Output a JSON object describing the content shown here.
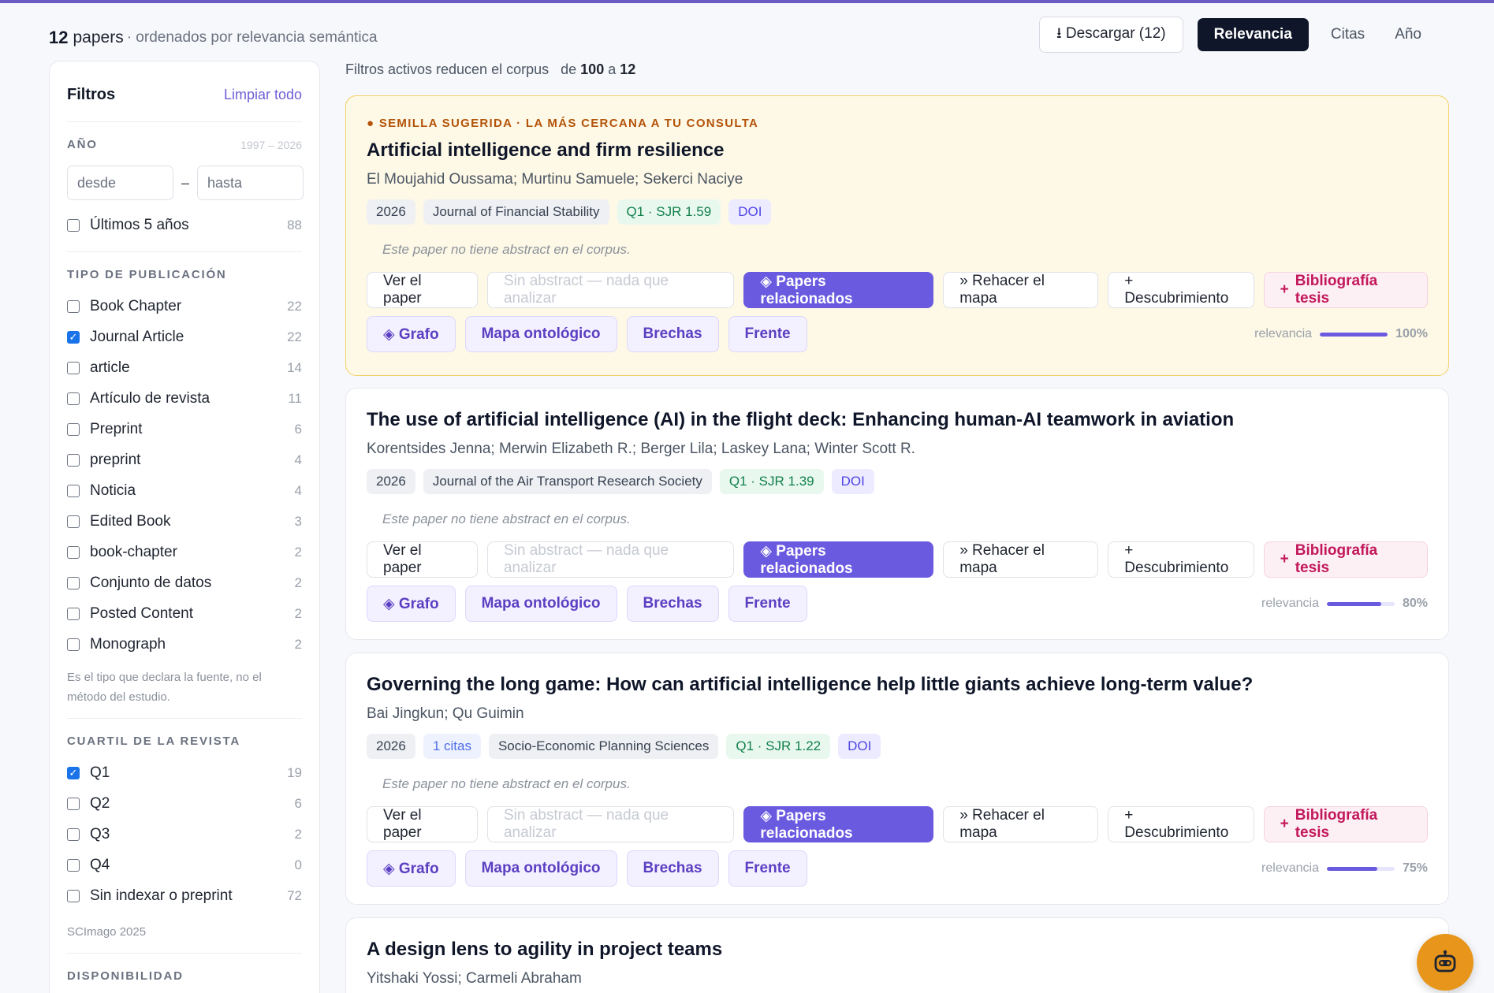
{
  "header": {
    "count": "12",
    "count_word": "papers",
    "sorted_by": "· ordenados por relevancia semántica",
    "download": "⭳ Descargar (12)",
    "sort_active": "Relevancia",
    "sort_citas": "Citas",
    "sort_year": "Año"
  },
  "sidebar": {
    "title": "Filtros",
    "clear": "Limpiar todo",
    "year": {
      "label": "AÑO",
      "range": "1997 – 2026",
      "from_placeholder": "desde",
      "to_placeholder": "hasta",
      "dash": "–",
      "last5_label": "Últimos 5 años",
      "last5_count": "88",
      "last5_checked": false
    },
    "pubtype": {
      "label": "TIPO DE PUBLICACIÓN",
      "items": [
        {
          "label": "Book Chapter",
          "count": "22",
          "checked": false
        },
        {
          "label": "Journal Article",
          "count": "22",
          "checked": true
        },
        {
          "label": "article",
          "count": "14",
          "checked": false
        },
        {
          "label": "Artículo de revista",
          "count": "11",
          "checked": false
        },
        {
          "label": "Preprint",
          "count": "6",
          "checked": false
        },
        {
          "label": "preprint",
          "count": "4",
          "checked": false
        },
        {
          "label": "Noticia",
          "count": "4",
          "checked": false
        },
        {
          "label": "Edited Book",
          "count": "3",
          "checked": false
        },
        {
          "label": "book-chapter",
          "count": "2",
          "checked": false
        },
        {
          "label": "Conjunto de datos",
          "count": "2",
          "checked": false
        },
        {
          "label": "Posted Content",
          "count": "2",
          "checked": false
        },
        {
          "label": "Monograph",
          "count": "2",
          "checked": false
        }
      ],
      "note": "Es el tipo que declara la fuente, no el método del estudio."
    },
    "quartile": {
      "label": "CUARTIL DE LA REVISTA",
      "items": [
        {
          "label": "Q1",
          "count": "19",
          "checked": true
        },
        {
          "label": "Q2",
          "count": "6",
          "checked": false
        },
        {
          "label": "Q3",
          "count": "2",
          "checked": false
        },
        {
          "label": "Q4",
          "count": "0",
          "checked": false
        },
        {
          "label": "Sin indexar o preprint",
          "count": "72",
          "checked": false
        }
      ],
      "note": "SCImago 2025"
    },
    "availability": {
      "label": "DISPONIBILIDAD"
    }
  },
  "corpus": {
    "prefix": "Filtros activos reducen el corpus",
    "de": "de",
    "from": "100",
    "a": "a",
    "to": "12"
  },
  "labels": {
    "ver": "Ver el paper",
    "sin_abstract": "Sin abstract — nada que analizar",
    "relacionados": "◈ Papers relacionados",
    "rehacer": "» Rehacer el mapa",
    "descubrimiento": "+ Descubrimiento",
    "bib_plus": "+",
    "bibliografia": "Bibliografía tesis",
    "grafo": "◈ Grafo",
    "mapa": "Mapa ontológico",
    "brechas": "Brechas",
    "frente": "Frente",
    "relevancia": "relevancia",
    "no_abstract": "Este paper no tiene abstract en el corpus."
  },
  "papers": [
    {
      "seed_tag": "● SEMILLA SUGERIDA · LA MÁS CERCANA A TU CONSULTA",
      "title": "Artificial intelligence and firm resilience",
      "authors": "El Moujahid Oussama; Murtinu Samuele; Sekerci Naciye",
      "year": "2026",
      "journal": "Journal of Financial Stability",
      "quartile": "Q1 · SJR 1.59",
      "doi": "DOI",
      "relevance": 100,
      "relevance_label": "100%"
    },
    {
      "title": "The use of artificial intelligence (AI) in the flight deck: Enhancing human-AI teamwork in aviation",
      "authors": "Korentsides Jenna; Merwin Elizabeth R.; Berger Lila; Laskey Lana; Winter Scott R.",
      "year": "2026",
      "journal": "Journal of the Air Transport Research Society",
      "quartile": "Q1 · SJR 1.39",
      "doi": "DOI",
      "relevance": 80,
      "relevance_label": "80%"
    },
    {
      "title": "Governing the long game: How can artificial intelligence help little giants achieve long-term value?",
      "authors": "Bai Jingkun; Qu Guimin",
      "year": "2026",
      "citas": "1 citas",
      "journal": "Socio-Economic Planning Sciences",
      "quartile": "Q1 · SJR 1.22",
      "doi": "DOI",
      "relevance": 75,
      "relevance_label": "75%"
    },
    {
      "title": "A design lens to agility in project teams",
      "authors": "Yitshaki Yossi; Carmeli Abraham"
    }
  ],
  "colors": {
    "accent": "#6a5ae0",
    "seed_bg": "#fef9e6",
    "seed_border": "#f3d06a",
    "fab": "#e7961b",
    "dark_button": "#0f1629"
  },
  "icons": {
    "fab": "robot-icon",
    "download": "download-icon"
  }
}
